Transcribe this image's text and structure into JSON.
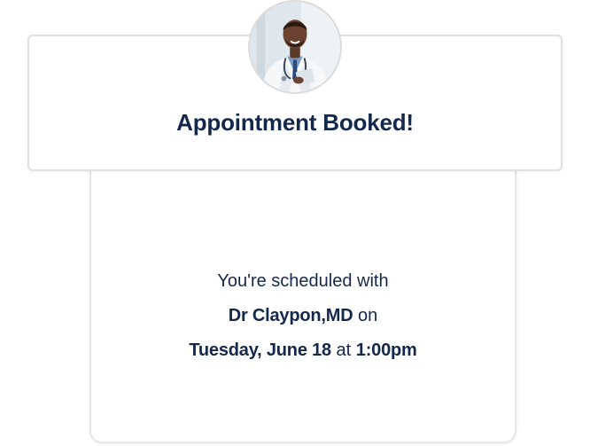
{
  "header": {
    "title": "Appointment Booked!"
  },
  "avatar": {
    "icon": "doctor-avatar-icon"
  },
  "details": {
    "intro": "You're scheduled with",
    "doctor_name": "Dr Claypon,MD",
    "on_word": "on",
    "date": "Tuesday, June 18",
    "at_word": "at",
    "time": "1:00pm"
  },
  "colors": {
    "text_primary": "#14284b",
    "card_border": "#e6e6e6",
    "background": "#ffffff"
  }
}
